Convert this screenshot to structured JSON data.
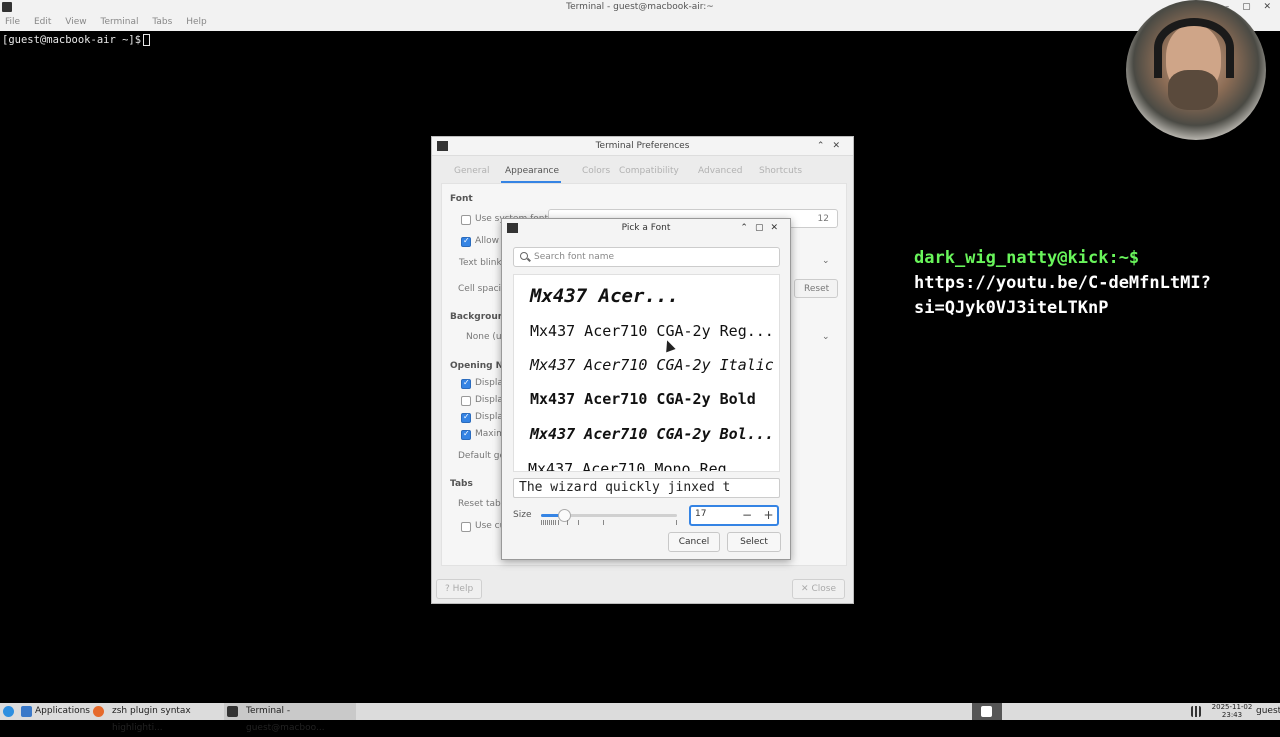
{
  "terminal": {
    "title": "Terminal - guest@macbook-air:~",
    "menu": [
      "File",
      "Edit",
      "View",
      "Terminal",
      "Tabs",
      "Help"
    ],
    "prompt": "[guest@macbook-air ~]$"
  },
  "overlay": {
    "user_line": "dark_wig_natty@kick:~$",
    "url_line1": "https://youtu.be/C-deMfnLtMI?",
    "url_line2": "si=QJyk0VJ3iteLTKnP"
  },
  "prefs": {
    "title": "Terminal Preferences",
    "tabs": [
      "General",
      "Appearance",
      "Colors",
      "Compatibility",
      "Advanced",
      "Shortcuts"
    ],
    "active_tab": "Appearance",
    "font_section": "Font",
    "use_system_font": "Use system font",
    "allow_bold": "Allow b",
    "font_size": "12",
    "text_blinks": "Text blinks:",
    "cell_spacing": "Cell spacing",
    "reset": "Reset",
    "background_section": "Background",
    "background_value": "None (use",
    "opening_section": "Opening New",
    "display_1": "Display",
    "display_2": "Display",
    "display_3": "Display",
    "maximize": "Maxim",
    "default_geometry": "Default geo",
    "tabs_section": "Tabs",
    "reset_tab": "Reset tab",
    "use_custom": "Use cu",
    "help_button": "Help",
    "close_button": "Close"
  },
  "pick_font": {
    "title": "Pick a Font",
    "search_placeholder": "Search font name",
    "fonts": [
      "Mx437 Acer...",
      "Mx437 Acer710 CGA-2y Reg...",
      "Mx437 Acer710 CGA-2y Italic",
      "Mx437 Acer710 CGA-2y Bold",
      "Mx437 Acer710 CGA-2y Bol...",
      "Mx437 Acer710 Mono Reg..."
    ],
    "preview_text": "The wizard quickly jinxed t",
    "size_label": "Size",
    "size_value": "17",
    "size_fraction": 0.15,
    "cancel": "Cancel",
    "select": "Select"
  },
  "taskbar": {
    "applications": "Applications",
    "firefox_task": "zsh plugin syntax highlighti...",
    "terminal_task": "Terminal - guest@macboo...",
    "date": "2025-11-02",
    "time": "23:43",
    "user": "guest"
  }
}
